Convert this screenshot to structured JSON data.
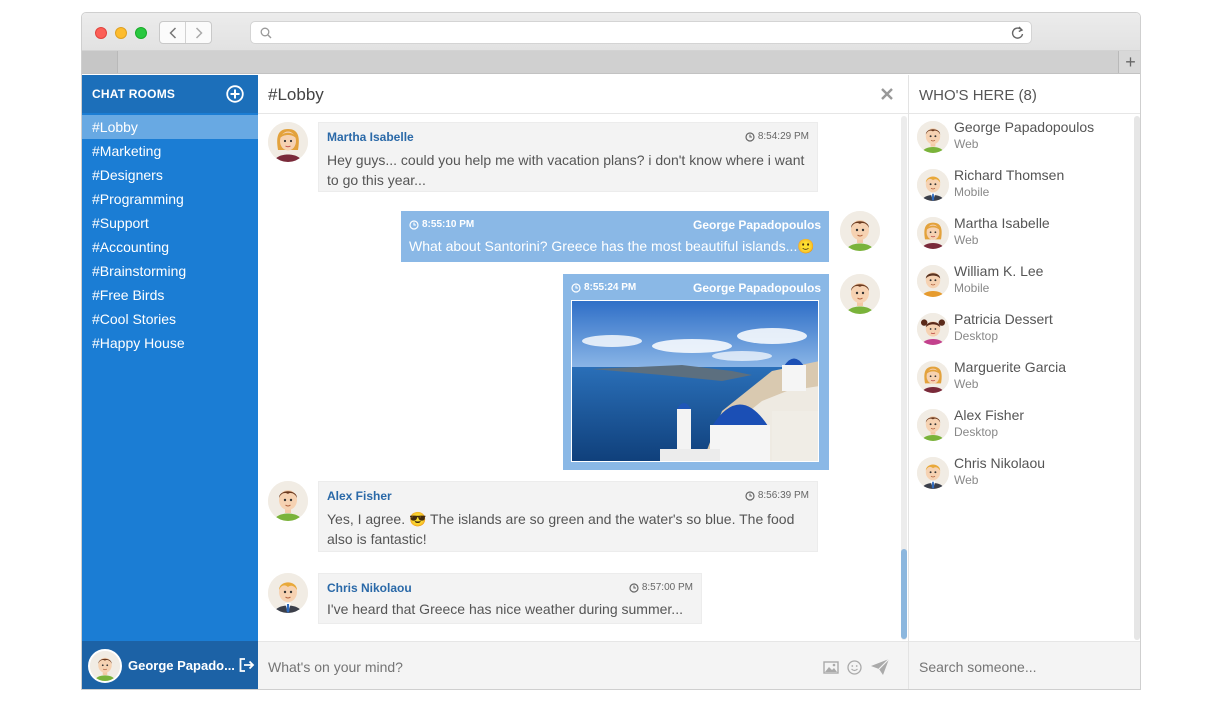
{
  "browser": {
    "url": ""
  },
  "sidebar": {
    "title": "CHAT ROOMS",
    "rooms": [
      {
        "label": "#Lobby",
        "active": true
      },
      {
        "label": "#Marketing"
      },
      {
        "label": "#Designers"
      },
      {
        "label": "#Programming"
      },
      {
        "label": "#Support"
      },
      {
        "label": "#Accounting"
      },
      {
        "label": "#Brainstorming"
      },
      {
        "label": "#Free Birds"
      },
      {
        "label": "#Cool Stories"
      },
      {
        "label": "#Happy House"
      }
    ],
    "current_user": "George Papado..."
  },
  "main": {
    "room_title": "#Lobby",
    "messages": [
      {
        "author": "Martha Isabelle",
        "time": "8:54:29 PM",
        "text": "Hey guys... could you help me with vacation plans? i don't know where i want to go this year..."
      },
      {
        "author": "George Papadopoulos",
        "time": "8:55:10 PM",
        "text": "What about Santorini? Greece has the most beautiful islands...",
        "emoji": "🙂"
      },
      {
        "author": "George Papadopoulos",
        "time": "8:55:24 PM",
        "image": "santorini-photo"
      },
      {
        "author": "Alex Fisher",
        "time": "8:56:39 PM",
        "text_a": "Yes, I agree. ",
        "emoji": "😎",
        "text_b": " The islands are so green and the water's so blue. The food also is fantastic!"
      },
      {
        "author": "Chris Nikolaou",
        "time": "8:57:00 PM",
        "text": "I've heard that Greece has nice weather during summer..."
      }
    ],
    "composer_placeholder": "What's on your mind?"
  },
  "users": {
    "title": "WHO'S HERE (8)",
    "list": [
      {
        "name": "George Papadopoulos",
        "device": "Web"
      },
      {
        "name": "Richard Thomsen",
        "device": "Mobile"
      },
      {
        "name": "Martha Isabelle",
        "device": "Web"
      },
      {
        "name": "William K. Lee",
        "device": "Mobile"
      },
      {
        "name": "Patricia Dessert",
        "device": "Desktop"
      },
      {
        "name": "Marguerite Garcia",
        "device": "Web"
      },
      {
        "name": "Alex Fisher",
        "device": "Desktop"
      },
      {
        "name": "Chris Nikolaou",
        "device": "Web"
      }
    ],
    "search_placeholder": "Search someone..."
  },
  "colors": {
    "sidebar": "#1b7dd4",
    "sidebar_header": "#1c6fba",
    "active_room": "#68a9e3",
    "own_bubble": "#8ab8e6",
    "author_link": "#2a69a8"
  }
}
